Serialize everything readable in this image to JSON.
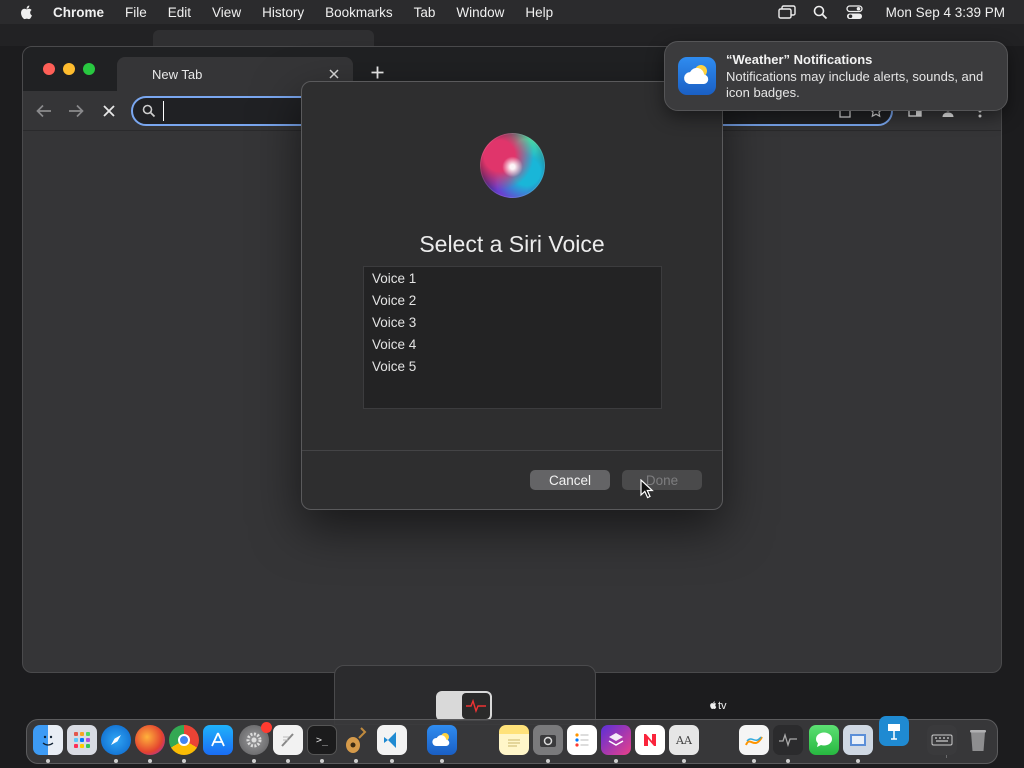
{
  "menubar": {
    "app_name": "Chrome",
    "items": [
      "File",
      "Edit",
      "View",
      "History",
      "Bookmarks",
      "Tab",
      "Window",
      "Help"
    ],
    "clock": "Mon Sep 4  3:39 PM"
  },
  "browser": {
    "tab_title": "New Tab",
    "omnibox_value": ""
  },
  "dialog": {
    "title": "Select a Siri Voice",
    "voices": [
      "Voice 1",
      "Voice 2",
      "Voice 3",
      "Voice 4",
      "Voice 5"
    ],
    "cancel_label": "Cancel",
    "done_label": "Done"
  },
  "notification": {
    "title": "“Weather” Notifications",
    "body": "Notifications may include alerts, sounds, and icon badges."
  },
  "dock_label": "tv",
  "dock_icons": [
    "finder-icon",
    "launchpad-icon",
    "safari-icon",
    "firefox-icon",
    "chrome-icon",
    "app-store-icon",
    "system-settings-icon",
    "script-editor-icon",
    "terminal-icon",
    "instruments-icon",
    "vscode-icon",
    "weather-icon",
    "notes-icon",
    "screenshot-icon",
    "reminders-icon",
    "shortcuts-icon",
    "news-icon",
    "font-book-icon",
    "freeform-icon",
    "activity-monitor-icon",
    "messages-icon",
    "preview-icon",
    "keynote-icon",
    "keyboard-viewer-icon",
    "trash-icon"
  ],
  "colors": {
    "accent_focus": "#7aa7f0",
    "close_red": "#fe5f57",
    "minimize_yellow": "#febc2e",
    "zoom_green": "#28c840"
  }
}
